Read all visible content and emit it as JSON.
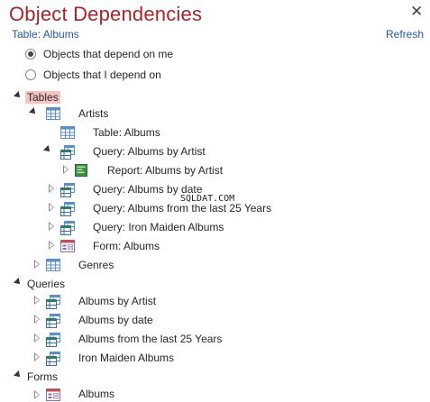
{
  "header": {
    "title": "Object Dependencies",
    "subtitle": "Table: Albums",
    "refresh_label": "Refresh",
    "close_glyph": "✕"
  },
  "options": {
    "depend_on_me": "Objects that depend on me",
    "i_depend_on": "Objects that I depend on",
    "selected": "depend_on_me"
  },
  "tree": {
    "tables_label": "Tables",
    "artists_label": "Artists",
    "table_albums_label": "Table: Albums",
    "query_albums_by_artist_label": "Query: Albums by Artist",
    "report_albums_by_artist_label": "Report: Albums by Artist",
    "query_albums_by_date_label": "Query: Albums by date",
    "query_albums_last25_label": "Query: Albums from the last 25 Years",
    "query_iron_maiden_label": "Query: Iron Maiden Albums",
    "form_albums_label": "Form: Albums",
    "genres_label": "Genres",
    "queries_label": "Queries",
    "q_albums_by_artist": "Albums by Artist",
    "q_albums_by_date": "Albums by date",
    "q_albums_last25": "Albums from the last 25 Years",
    "q_iron_maiden": "Iron Maiden Albums",
    "forms_label": "Forms",
    "f_albums": "Albums"
  },
  "watermark": "SQLDAT.COM",
  "colors": {
    "title": "#a4262c",
    "link": "#2b579a",
    "highlight": "#f4c4c0",
    "table_icon": "#5b8fc7",
    "report_icon": "#3f8f3f",
    "form_icon": "#c0504d"
  },
  "icons": {
    "table": "table-icon",
    "query": "query-icon",
    "report": "report-icon",
    "form": "form-icon"
  }
}
